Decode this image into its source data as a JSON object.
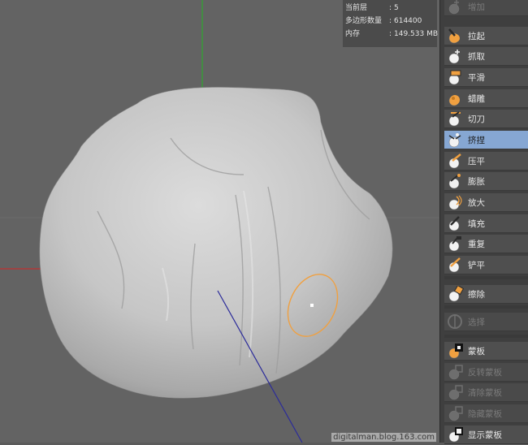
{
  "stats": {
    "rows": [
      {
        "key": "当前层",
        "value": "5"
      },
      {
        "key": "多边形数量",
        "value": "614400"
      },
      {
        "key": "内存",
        "value": "149.533 MB"
      }
    ]
  },
  "tools": [
    {
      "label": "增加",
      "icon": "add-brush-icon",
      "state": "disabled"
    },
    {
      "label": "拉起",
      "icon": "pull-brush-icon",
      "state": "normal"
    },
    {
      "label": "抓取",
      "icon": "grab-brush-icon",
      "state": "normal"
    },
    {
      "label": "平滑",
      "icon": "smooth-brush-icon",
      "state": "normal"
    },
    {
      "label": "蜡雕",
      "icon": "wax-brush-icon",
      "state": "normal"
    },
    {
      "label": "切刀",
      "icon": "knife-brush-icon",
      "state": "normal"
    },
    {
      "label": "挤捏",
      "icon": "pinch-brush-icon",
      "state": "selected"
    },
    {
      "label": "压平",
      "icon": "flatten-brush-icon",
      "state": "normal"
    },
    {
      "label": "膨胀",
      "icon": "inflate-brush-icon",
      "state": "normal"
    },
    {
      "label": "放大",
      "icon": "amplify-brush-icon",
      "state": "normal"
    },
    {
      "label": "填充",
      "icon": "fill-brush-icon",
      "state": "normal"
    },
    {
      "label": "重复",
      "icon": "repeat-brush-icon",
      "state": "normal"
    },
    {
      "label": "铲平",
      "icon": "scrape-brush-icon",
      "state": "normal"
    },
    {
      "label": "擦除",
      "icon": "erase-brush-icon",
      "state": "normal"
    },
    {
      "label": "选择",
      "icon": "select-icon",
      "state": "disabled"
    },
    {
      "label": "蒙板",
      "icon": "mask-brush-icon",
      "state": "normal"
    },
    {
      "label": "反转蒙板",
      "icon": "invert-mask-icon",
      "state": "disabled"
    },
    {
      "label": "清除蒙板",
      "icon": "clear-mask-icon",
      "state": "disabled"
    },
    {
      "label": "隐藏蒙板",
      "icon": "hide-mask-icon",
      "state": "disabled"
    },
    {
      "label": "显示蒙板",
      "icon": "show-mask-icon",
      "state": "normal"
    }
  ],
  "colors": {
    "accent_orange": "#f0a040",
    "selected_bg": "#86a7d3",
    "axis_green": "#2fa82f",
    "axis_red": "#c03030",
    "axis_blue": "#2b2b9a"
  },
  "watermark": "digitalman.blog.163.com"
}
